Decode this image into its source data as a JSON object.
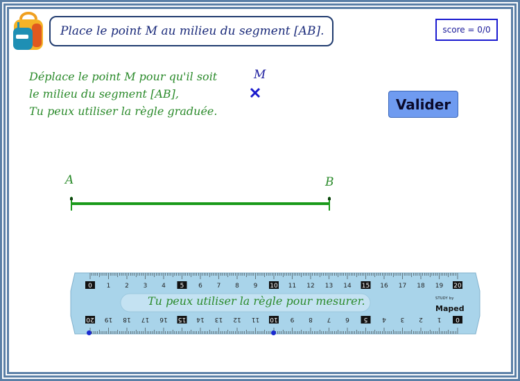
{
  "header": {
    "title": "Place le point M au milieu du segment [AB].",
    "score": "score = 0/0",
    "backpack_icon": "backpack-icon"
  },
  "instructions": {
    "line1": "Déplace le point M pour qu'il soit",
    "line2": "le milieu du segment [AB],",
    "line3": "Tu peux utiliser la règle graduée."
  },
  "point_m": {
    "label": "M",
    "marker": "×",
    "color": "#1a1acc"
  },
  "validate_button": {
    "label": "Valider",
    "color": "#6f9bf0"
  },
  "segment": {
    "label_a": "A",
    "label_b": "B",
    "color": "#1a9a1a"
  },
  "ruler": {
    "caption": "Tu peux utiliser la règle pour mesurer.",
    "brand_small": "STUDY by",
    "brand_name": "Maped",
    "top_numbers": [
      "0",
      "1",
      "2",
      "3",
      "4",
      "5",
      "6",
      "7",
      "8",
      "9",
      "10",
      "11",
      "12",
      "13",
      "14",
      "15",
      "16",
      "17",
      "18",
      "19",
      "20"
    ],
    "boxed_numbers": [
      "0",
      "5",
      "10",
      "15",
      "20"
    ],
    "color": "#a9d4ea"
  }
}
